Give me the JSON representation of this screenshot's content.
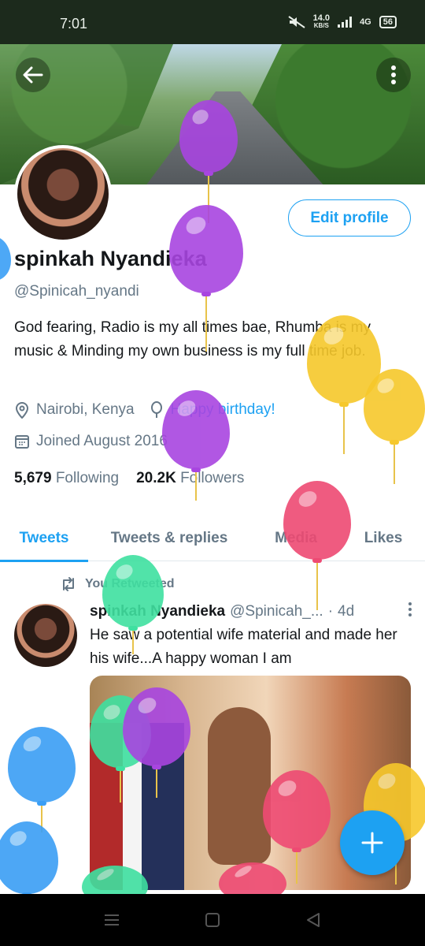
{
  "status_bar": {
    "time": "7:01",
    "net_speed_value": "14.0",
    "net_speed_unit": "KB/S",
    "network_label": "4G",
    "battery_level": "56"
  },
  "header": {
    "back_icon": "arrow-left-icon",
    "more_icon": "more-vertical-icon"
  },
  "profile": {
    "edit_label": "Edit profile",
    "name": "spinkah Nyandieka",
    "handle": "@Spinicah_nyandi",
    "bio": "God fearing, Radio is my all times bae, Rhumba is my music & Minding my own business is my full time job.",
    "location": "Nairobi, Kenya",
    "birthday": "Happy birthday!",
    "joined": "Joined August 2016",
    "following_count": "5,679",
    "following_label": "Following",
    "followers_count": "20.2K",
    "followers_label": "Followers"
  },
  "tabs": [
    "Tweets",
    "Tweets & replies",
    "Media",
    "Likes"
  ],
  "active_tab": "Tweets",
  "tweet": {
    "retweet_label": "You Retweeted",
    "author": "spinkah Nyandieka",
    "handle": "@Spinicah_...",
    "separator": "·",
    "time": "4d",
    "text": "He saw a potential wife material and made her his wife...A happy woman I am"
  },
  "colors": {
    "accent": "#1da1f2",
    "muted": "#657786",
    "balloon_purple": "#a845e0",
    "balloon_yellow": "#f6c82b",
    "balloon_pink": "#ee4a73",
    "balloon_green": "#3fe0a0",
    "balloon_blue": "#3a9ef5"
  }
}
